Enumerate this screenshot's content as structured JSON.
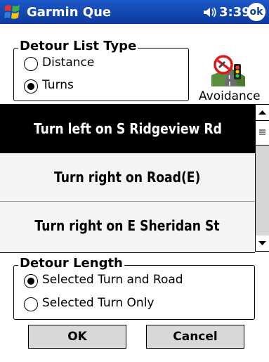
{
  "titlebar": {
    "app_title": "Garmin Que",
    "time": "3:39",
    "ok_label": "ok",
    "start_icon": "windows-flag-icon",
    "speaker_icon": "speaker-icon"
  },
  "detour_list_type": {
    "legend": "Detour List Type",
    "options": [
      {
        "label": "Distance",
        "checked": false
      },
      {
        "label": "Turns",
        "checked": true
      }
    ]
  },
  "avoidance": {
    "label": "Avoidance",
    "icon": "no-road-avoidance-icon"
  },
  "turns": [
    {
      "text": "Turn left on S Ridgeview Rd",
      "selected": true
    },
    {
      "text": "Turn right on Road(E)",
      "selected": false
    },
    {
      "text": "Turn right on E Sheridan St",
      "selected": false
    }
  ],
  "detour_length": {
    "legend": "Detour Length",
    "options": [
      {
        "label": "Selected Turn and Road",
        "checked": true
      },
      {
        "label": "Selected Turn Only",
        "checked": false
      }
    ]
  },
  "buttons": {
    "ok": "OK",
    "cancel": "Cancel"
  },
  "colors": {
    "titlebar": "#1c58c8",
    "selected_row": "#000000",
    "button_face": "#d8d8d8"
  }
}
